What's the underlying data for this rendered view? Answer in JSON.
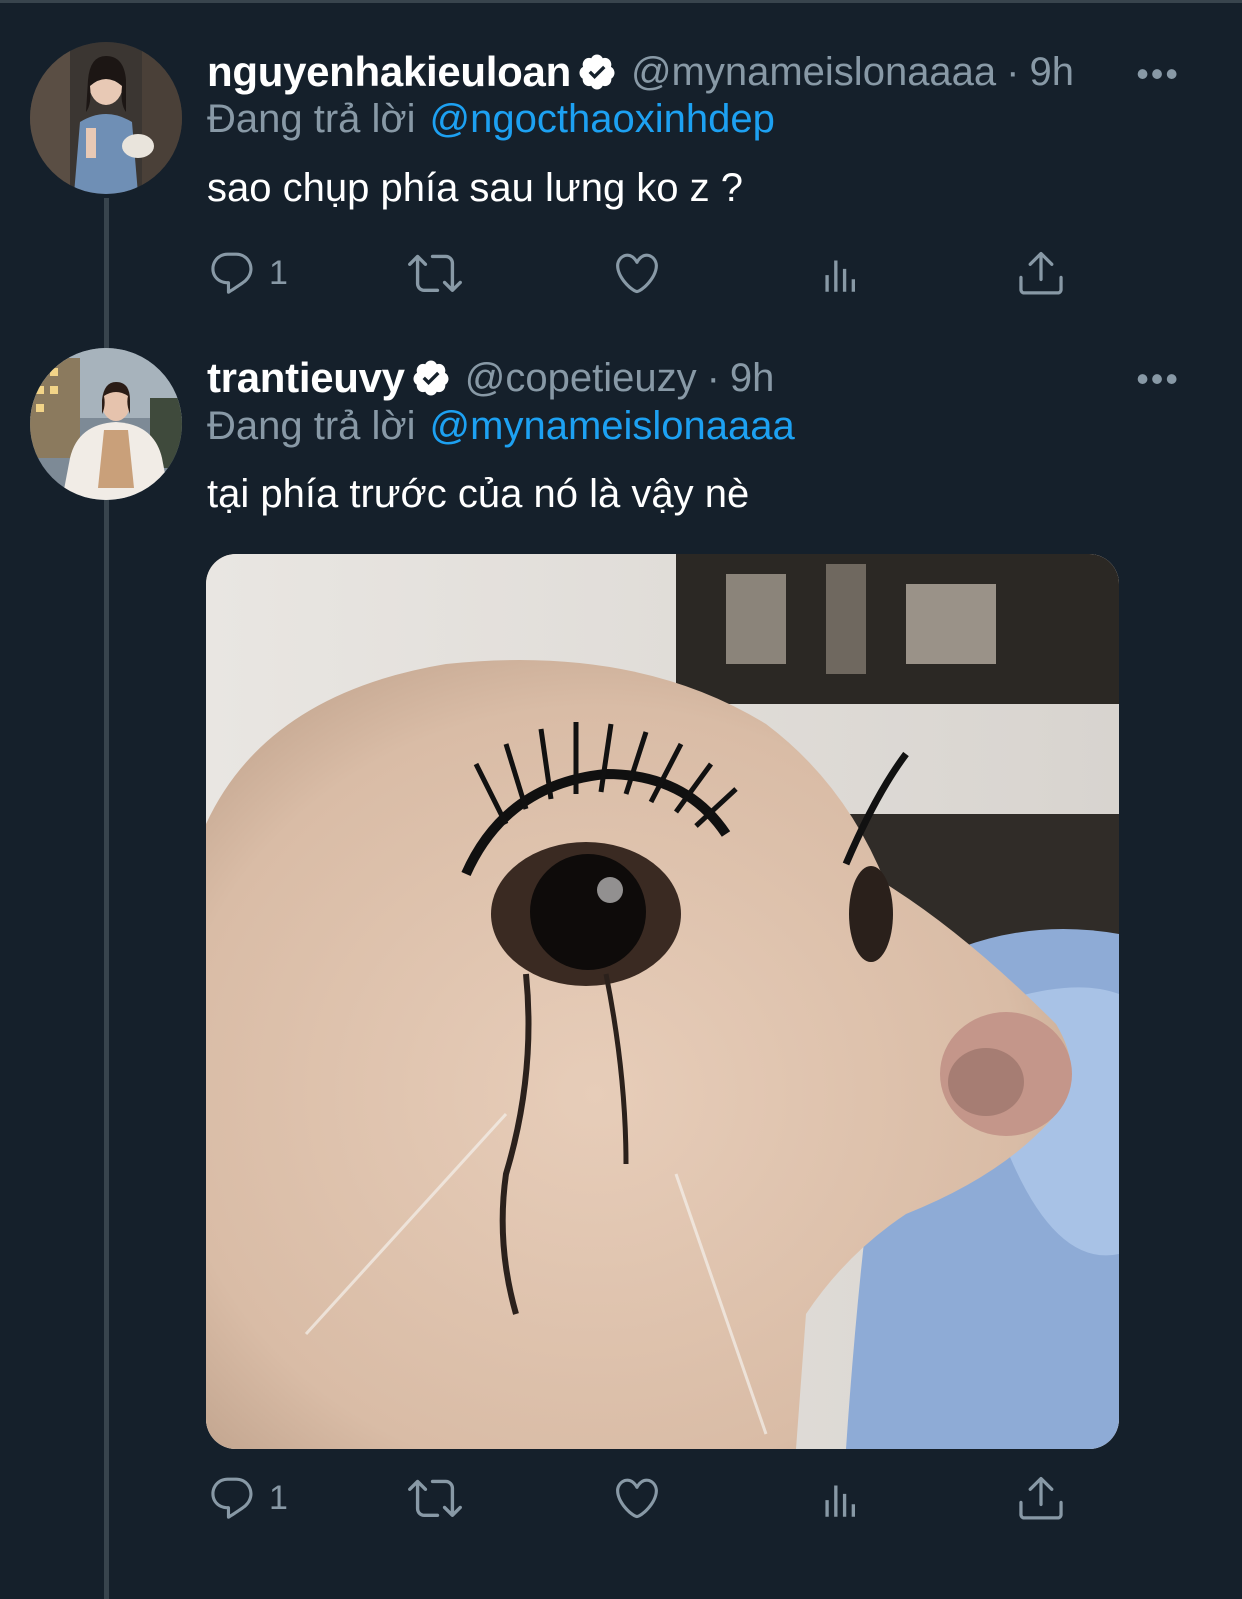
{
  "tweets": [
    {
      "name": "nguyenhakieuloan",
      "handle": "@mynameislonaaaa",
      "dot": "·",
      "time": "9h",
      "replying_prefix": "Đang trả lời",
      "replying_to": "@ngocthaoxinhdep",
      "text": "sao chụp phía sau lưng ko z ?",
      "reply_count": "1",
      "more": "•••"
    },
    {
      "name": "trantieuvy",
      "handle": "@copetieuzy",
      "dot": "·",
      "time": "9h",
      "replying_prefix": "Đang trả lời",
      "replying_to": "@mynameislonaaaa",
      "text": "tại phía trước của nó là vậy nè",
      "reply_count": "1",
      "more": "•••"
    }
  ],
  "colors": {
    "background": "#15202b",
    "muted": "#8899a6",
    "link": "#1da1f2",
    "divider": "#38444d"
  },
  "icons": [
    "reply-icon",
    "retweet-icon",
    "like-icon",
    "analytics-icon",
    "share-icon",
    "verified-icon",
    "more-icon"
  ]
}
